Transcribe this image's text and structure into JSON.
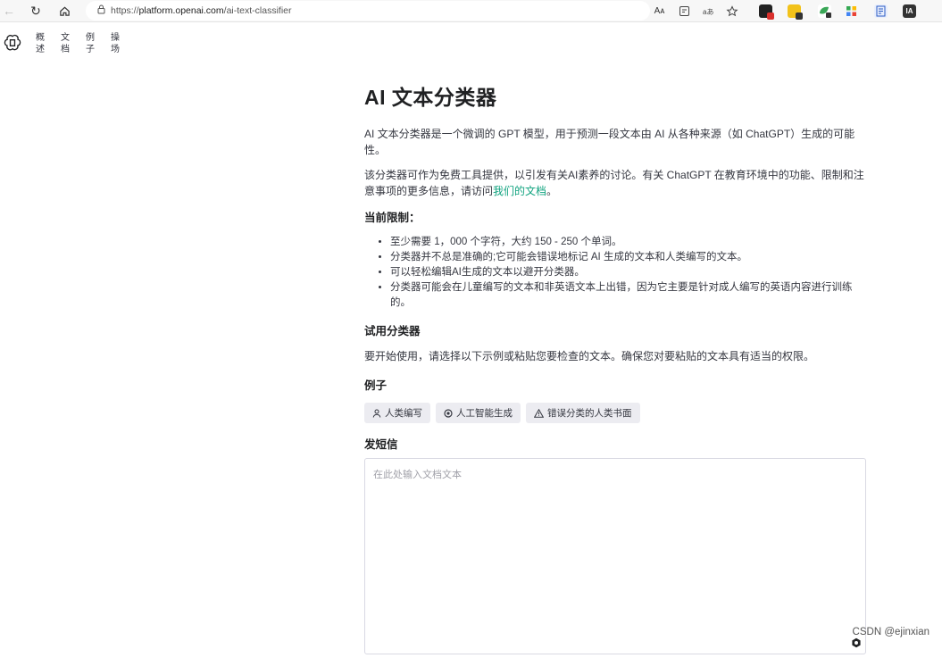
{
  "browser": {
    "url_prefix": "https://",
    "url_host": "platform.openai.com",
    "url_path": "/ai-text-classifier",
    "reader_label": "Aᴀ",
    "ext_ia_label": "IA"
  },
  "nav": {
    "items": [
      {
        "line1": "概",
        "line2": "述"
      },
      {
        "line1": "文",
        "line2": "档"
      },
      {
        "line1": "例",
        "line2": "子"
      },
      {
        "line1": "操",
        "line2": "场"
      }
    ]
  },
  "page": {
    "title": "AI 文本分类器",
    "intro": "AI 文本分类器是一个微调的 GPT 模型，用于预测一段文本由 AI 从各种来源（如 ChatGPT）生成的可能性。",
    "para2_prefix": "该分类器可作为免费工具提供，以引发有关AI素养的讨论。有关 ChatGPT 在教育环境中的功能、限制和注意事项的更多信息，请访问",
    "para2_link": "我们的文档",
    "para2_suffix": "。",
    "limits_heading": "当前限制：",
    "limits": [
      "至少需要 1，000 个字符，大约 150 - 250 个单词。",
      "分类器并不总是准确的;它可能会错误地标记 AI 生成的文本和人类编写的文本。",
      "可以轻松编辑AI生成的文本以避开分类器。",
      "分类器可能会在儿童编写的文本和非英语文本上出错，因为它主要是针对成人编写的英语内容进行训练的。"
    ],
    "try_heading": "试用分类器",
    "try_text": "要开始使用，请选择以下示例或粘贴您要检查的文本。确保您对要粘贴的文本具有适当的权限。",
    "examples_heading": "例子",
    "examples": [
      {
        "label": "人类编写",
        "icon": "person-icon"
      },
      {
        "label": "人工智能生成",
        "icon": "openai-icon"
      },
      {
        "label": "错误分类的人类书面",
        "icon": "warning-icon"
      }
    ],
    "text_heading": "发短信",
    "textarea_placeholder": "在此处输入文档文本"
  },
  "watermark": "CSDN @ejinxian"
}
